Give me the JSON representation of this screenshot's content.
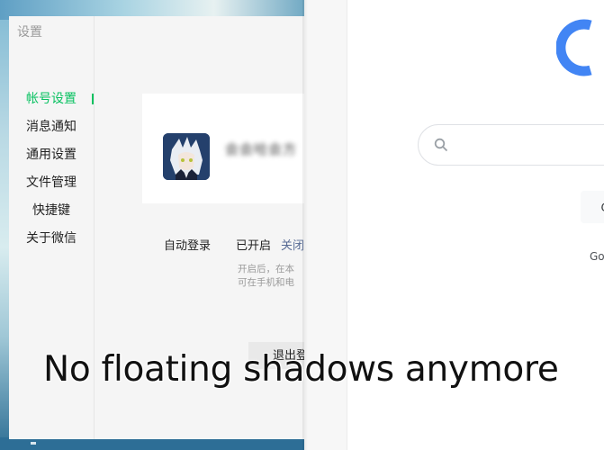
{
  "settings": {
    "title": "设置",
    "nav": [
      {
        "label": "帐号设置"
      },
      {
        "label": "消息通知"
      },
      {
        "label": "通用设置"
      },
      {
        "label": "文件管理"
      },
      {
        "label": "快捷键"
      },
      {
        "label": "关于微信"
      }
    ],
    "profile": {
      "blurred_name": "会会哈会方"
    },
    "auto_login": {
      "label": "自动登录",
      "status": "已开启",
      "action": "关闭"
    },
    "hint_line1": "开启后，在本",
    "hint_line2": "可在手机和电",
    "logout_label": "退出登"
  },
  "browser": {
    "search_placeholder": "",
    "button_label": "G",
    "footer_text": "Go"
  },
  "caption": "No floating shadows anymore",
  "colors": {
    "accent_green": "#07c160",
    "link_blue": "#576b95",
    "google_blue": "#4285f4"
  }
}
